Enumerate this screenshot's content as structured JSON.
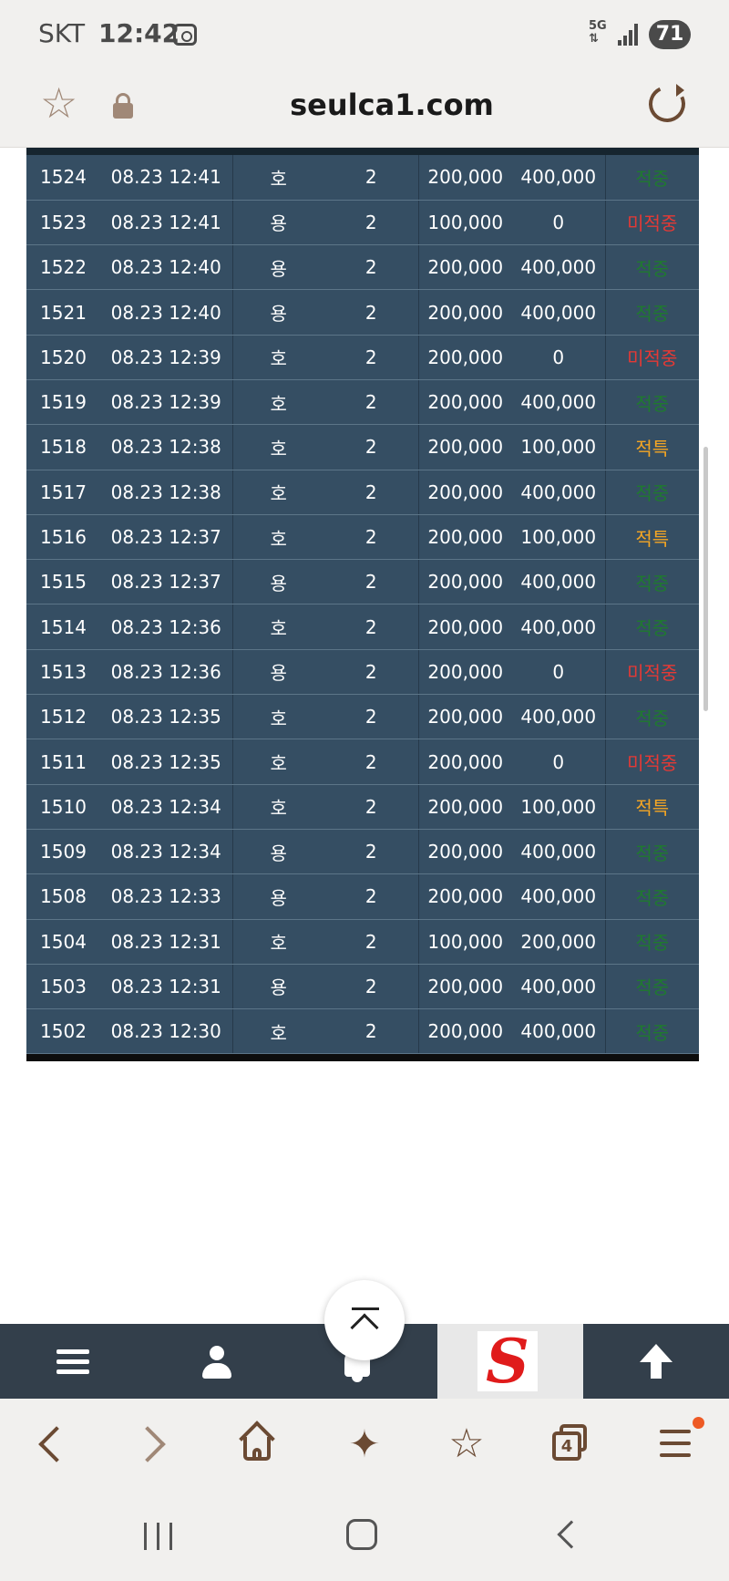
{
  "status_bar": {
    "carrier": "SKT",
    "time": "12:42",
    "network": "5G",
    "battery": "71"
  },
  "url_bar": {
    "url": "seulca1.com",
    "icons": [
      "star-icon",
      "lock-icon",
      "reload-icon"
    ]
  },
  "colors": {
    "table_row": "#354e63",
    "status_win": "#1f7a2f",
    "status_miss": "#e53935",
    "status_special": "#f5a623",
    "nav_bar": "#333f4b",
    "brown_icon": "#6b4a33"
  },
  "table": {
    "rows": [
      {
        "no": "1524",
        "time": "08.23 12:41",
        "pick": "호",
        "odds": "2",
        "bet": "200,000",
        "payout": "400,000",
        "status": "적중",
        "status_type": "green"
      },
      {
        "no": "1523",
        "time": "08.23 12:41",
        "pick": "용",
        "odds": "2",
        "bet": "100,000",
        "payout": "0",
        "status": "미적중",
        "status_type": "red"
      },
      {
        "no": "1522",
        "time": "08.23 12:40",
        "pick": "용",
        "odds": "2",
        "bet": "200,000",
        "payout": "400,000",
        "status": "적중",
        "status_type": "green"
      },
      {
        "no": "1521",
        "time": "08.23 12:40",
        "pick": "용",
        "odds": "2",
        "bet": "200,000",
        "payout": "400,000",
        "status": "적중",
        "status_type": "green"
      },
      {
        "no": "1520",
        "time": "08.23 12:39",
        "pick": "호",
        "odds": "2",
        "bet": "200,000",
        "payout": "0",
        "status": "미적중",
        "status_type": "red"
      },
      {
        "no": "1519",
        "time": "08.23 12:39",
        "pick": "호",
        "odds": "2",
        "bet": "200,000",
        "payout": "400,000",
        "status": "적중",
        "status_type": "green"
      },
      {
        "no": "1518",
        "time": "08.23 12:38",
        "pick": "호",
        "odds": "2",
        "bet": "200,000",
        "payout": "100,000",
        "status": "적특",
        "status_type": "orange"
      },
      {
        "no": "1517",
        "time": "08.23 12:38",
        "pick": "호",
        "odds": "2",
        "bet": "200,000",
        "payout": "400,000",
        "status": "적중",
        "status_type": "green"
      },
      {
        "no": "1516",
        "time": "08.23 12:37",
        "pick": "호",
        "odds": "2",
        "bet": "200,000",
        "payout": "100,000",
        "status": "적특",
        "status_type": "orange"
      },
      {
        "no": "1515",
        "time": "08.23 12:37",
        "pick": "용",
        "odds": "2",
        "bet": "200,000",
        "payout": "400,000",
        "status": "적중",
        "status_type": "green"
      },
      {
        "no": "1514",
        "time": "08.23 12:36",
        "pick": "호",
        "odds": "2",
        "bet": "200,000",
        "payout": "400,000",
        "status": "적중",
        "status_type": "green"
      },
      {
        "no": "1513",
        "time": "08.23 12:36",
        "pick": "용",
        "odds": "2",
        "bet": "200,000",
        "payout": "0",
        "status": "미적중",
        "status_type": "red"
      },
      {
        "no": "1512",
        "time": "08.23 12:35",
        "pick": "호",
        "odds": "2",
        "bet": "200,000",
        "payout": "400,000",
        "status": "적중",
        "status_type": "green"
      },
      {
        "no": "1511",
        "time": "08.23 12:35",
        "pick": "호",
        "odds": "2",
        "bet": "200,000",
        "payout": "0",
        "status": "미적중",
        "status_type": "red"
      },
      {
        "no": "1510",
        "time": "08.23 12:34",
        "pick": "호",
        "odds": "2",
        "bet": "200,000",
        "payout": "100,000",
        "status": "적특",
        "status_type": "orange"
      },
      {
        "no": "1509",
        "time": "08.23 12:34",
        "pick": "용",
        "odds": "2",
        "bet": "200,000",
        "payout": "400,000",
        "status": "적중",
        "status_type": "green"
      },
      {
        "no": "1508",
        "time": "08.23 12:33",
        "pick": "용",
        "odds": "2",
        "bet": "200,000",
        "payout": "400,000",
        "status": "적중",
        "status_type": "green"
      },
      {
        "no": "1504",
        "time": "08.23 12:31",
        "pick": "호",
        "odds": "2",
        "bet": "100,000",
        "payout": "200,000",
        "status": "적중",
        "status_type": "green"
      },
      {
        "no": "1503",
        "time": "08.23 12:31",
        "pick": "용",
        "odds": "2",
        "bet": "200,000",
        "payout": "400,000",
        "status": "적중",
        "status_type": "green"
      },
      {
        "no": "1502",
        "time": "08.23 12:30",
        "pick": "호",
        "odds": "2",
        "bet": "200,000",
        "payout": "400,000",
        "status": "적중",
        "status_type": "green"
      }
    ]
  },
  "site_nav": {
    "items": [
      "menu-icon",
      "user-icon",
      "bell-icon",
      "site-logo",
      "up-arrow-icon"
    ],
    "logo_letter": "S"
  },
  "browser_toolbar": {
    "tab_count": "4",
    "icons": [
      "back-icon",
      "forward-icon",
      "home-icon",
      "sparkle-icon",
      "favorites-list-icon",
      "tabs-icon",
      "menu-icon"
    ]
  },
  "system_nav": {
    "icons": [
      "recents-icon",
      "home-icon",
      "back-icon"
    ]
  }
}
